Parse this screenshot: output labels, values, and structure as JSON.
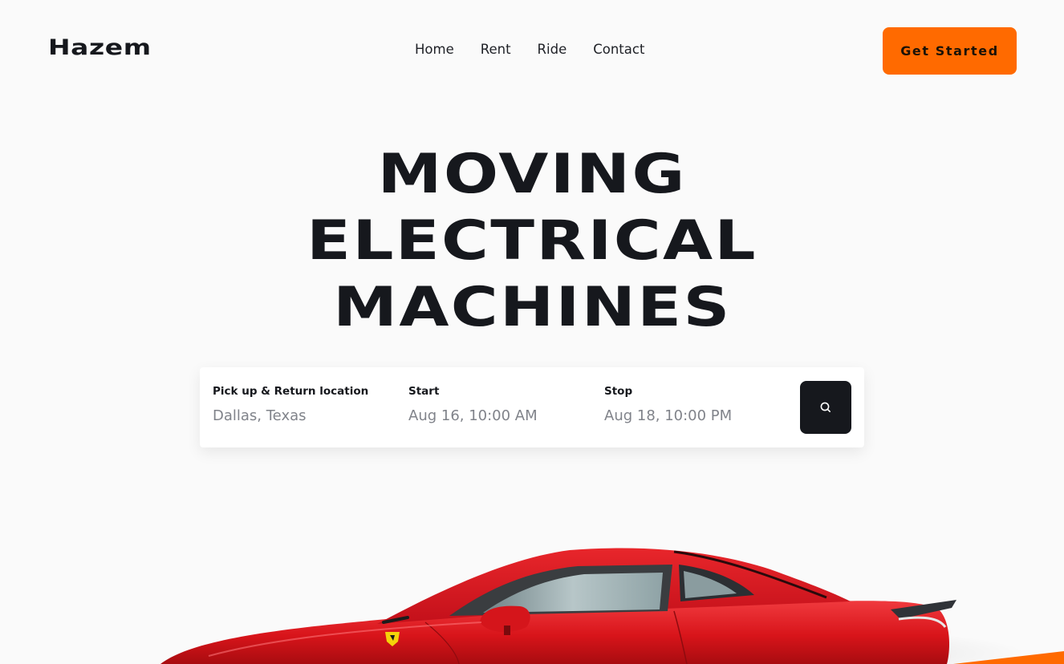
{
  "header": {
    "logo": "Hazem",
    "nav": [
      "Home",
      "Rent",
      "Ride",
      "Contact"
    ],
    "cta_label": "Get Started"
  },
  "hero": {
    "lines": [
      "MOVING",
      "ELECTRICAL",
      "MACHINES"
    ]
  },
  "search": {
    "location_label": "Pick up & Return location",
    "location_value": "Dallas, Texas",
    "start_label": "Start",
    "start_value": "Aug 16, 10:00 AM",
    "stop_label": "Stop",
    "stop_value": "Aug 18, 10:00 PM",
    "button_icon": "search-icon"
  },
  "colors": {
    "accent": "#ff6a00",
    "dark": "#16181d",
    "background": "#fafafa",
    "car": "#e0161c"
  }
}
